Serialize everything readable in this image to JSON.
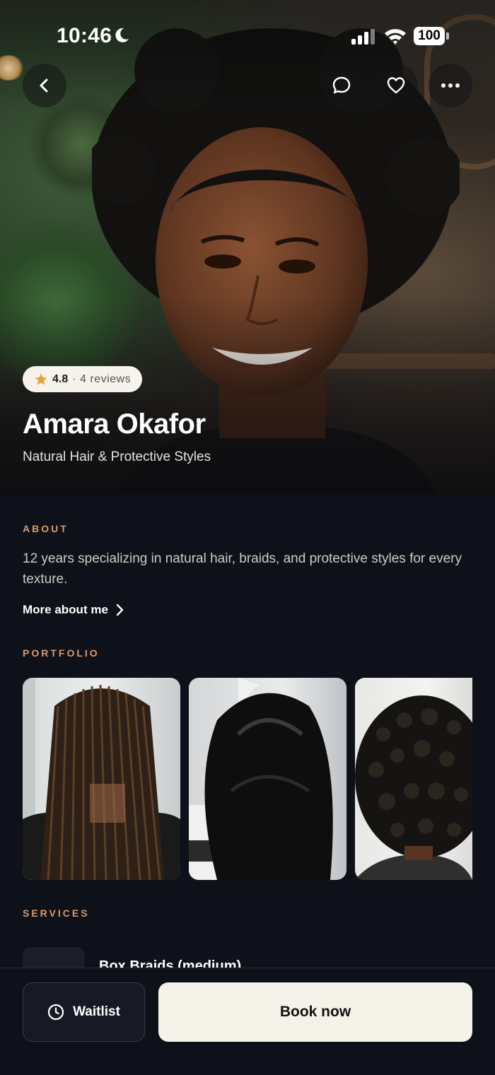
{
  "status_bar": {
    "time": "10:46",
    "battery": "100"
  },
  "profile": {
    "rating": "4.8",
    "reviews": "· 4 reviews",
    "name": "Amara Okafor",
    "specialty": "Natural Hair & Protective Styles"
  },
  "about": {
    "label": "ABOUT",
    "text": "12 years specializing in natural hair, braids, and protective styles for every texture.",
    "more_link": "More about me"
  },
  "portfolio": {
    "label": "PORTFOLIO"
  },
  "services": {
    "label": "SERVICES",
    "items": [
      {
        "name": "Box Braids (medium)"
      }
    ]
  },
  "actions": {
    "waitlist": "Waitlist",
    "book": "Book now"
  },
  "colors": {
    "accent": "#d99a6c",
    "background": "#0f111a",
    "primary_button": "#f5f2ea"
  },
  "icons": [
    "moon-icon",
    "signal-icon",
    "wifi-icon",
    "battery-icon",
    "back-icon",
    "chat-icon",
    "heart-icon",
    "more-icon",
    "star-icon",
    "chevron-right-icon",
    "clock-icon"
  ]
}
